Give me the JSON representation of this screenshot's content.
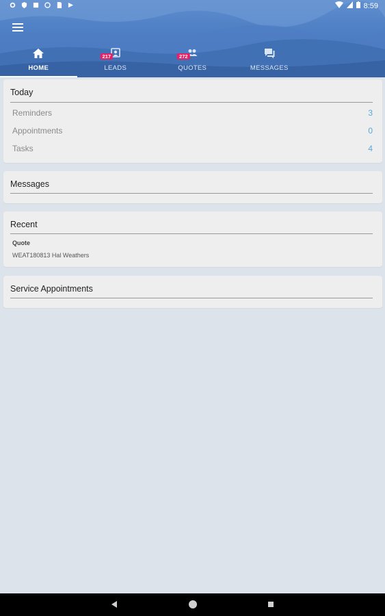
{
  "status_bar": {
    "time": "8:59",
    "icons": [
      "settings-icon",
      "shield-icon",
      "notification-icon",
      "circle-icon",
      "sim-icon",
      "play-icon"
    ],
    "right_icons": [
      "wifi-icon",
      "signal-icon",
      "battery-icon"
    ]
  },
  "header": {
    "menu_icon": "hamburger-menu-icon",
    "tabs": [
      {
        "label": "HOME",
        "icon": "home-icon",
        "active": true,
        "badge": ""
      },
      {
        "label": "LEADS",
        "icon": "leads-icon",
        "active": false,
        "badge": "217"
      },
      {
        "label": "QUOTES",
        "icon": "quotes-icon",
        "active": false,
        "badge": "272"
      },
      {
        "label": "MESSAGES",
        "icon": "messages-icon",
        "active": false,
        "badge": ""
      }
    ]
  },
  "today": {
    "title": "Today",
    "rows": [
      {
        "label": "Reminders",
        "value": "3"
      },
      {
        "label": "Appointments",
        "value": "0"
      },
      {
        "label": "Tasks",
        "value": "4"
      }
    ]
  },
  "messages": {
    "title": "Messages"
  },
  "recent": {
    "title": "Recent",
    "item_type": "Quote",
    "item_description": "WEAT180813 Hal Weathers"
  },
  "service_appointments": {
    "title": "Service Appointments"
  },
  "colors": {
    "header_blue": "#4f7fc4",
    "badge_pink": "#e91e63",
    "value_blue": "#5aa8d8",
    "background": "#dde3ea"
  }
}
